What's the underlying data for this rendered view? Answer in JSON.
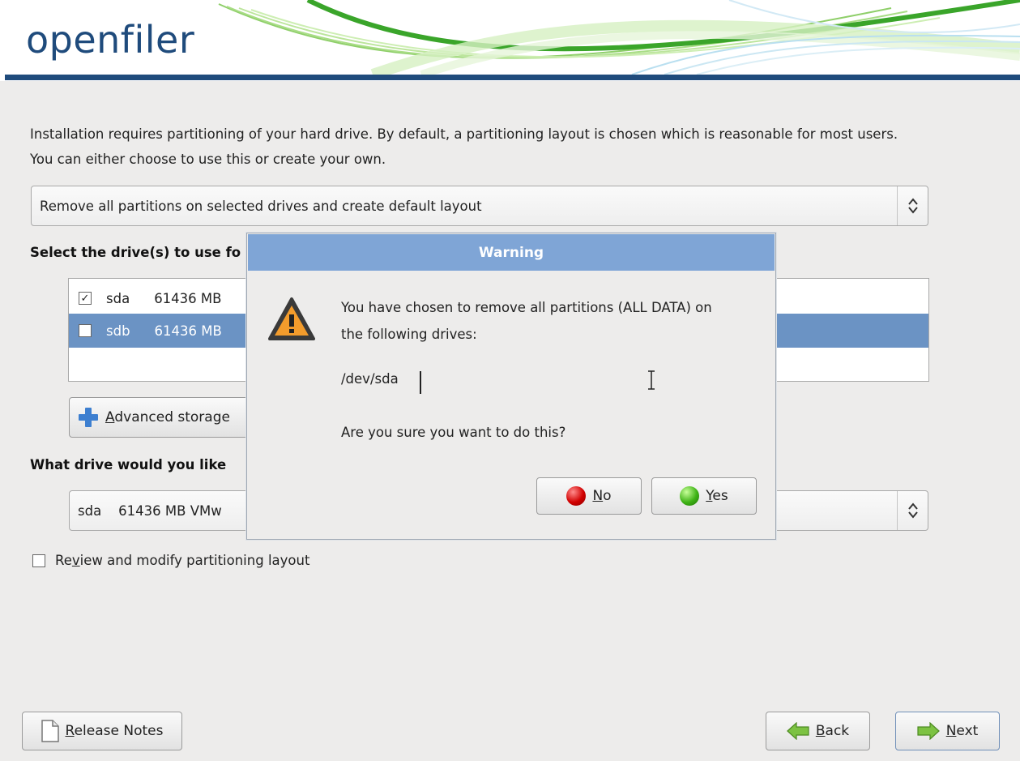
{
  "header": {
    "logo_text": "openfiler"
  },
  "intro": {
    "line1": "Installation requires partitioning of your hard drive.  By default, a partitioning layout is chosen which is reasonable for most users.",
    "line2": "You can either choose to use this or create your own."
  },
  "layout_combo": {
    "value": "Remove all partitions on selected drives and create default layout"
  },
  "drives_section": {
    "label": "Select the drive(s) to use fo"
  },
  "drives": [
    {
      "name": "sda",
      "size": "61436 MB",
      "checked": true,
      "check_glyph": "✓",
      "selected": false
    },
    {
      "name": "sdb",
      "size": "61436 MB",
      "checked": false,
      "check_glyph": "",
      "selected": true
    }
  ],
  "advanced_button": {
    "label_first": "A",
    "label_rest": "dvanced storage"
  },
  "boot_section": {
    "label": "What drive would you like"
  },
  "boot_combo": {
    "value": "sda    61436 MB VMw"
  },
  "review_checkbox": {
    "label_pre": "Re",
    "label_ul": "v",
    "label_post": "iew and modify partitioning layout",
    "checked": false
  },
  "footer": {
    "release_notes": {
      "first": "R",
      "rest": "elease Notes"
    },
    "back": {
      "first": "B",
      "rest": "ack"
    },
    "next": {
      "first": "N",
      "rest": "ext"
    }
  },
  "dialog": {
    "title": "Warning",
    "message_line1": "You have chosen to remove all partitions (ALL DATA) on",
    "message_line2": "the following drives:",
    "device": "/dev/sda",
    "question": "Are you sure you want to do this?",
    "no": {
      "first": "N",
      "rest": "o"
    },
    "yes": {
      "first": "Y",
      "rest": "es"
    }
  },
  "colors": {
    "brand": "#1f4b7c",
    "dialog_title": "#7fa5d6",
    "selection": "#6b93c4",
    "no_dot": "#d10000",
    "yes_dot": "#3fb316",
    "warning": "#f39c2c"
  }
}
